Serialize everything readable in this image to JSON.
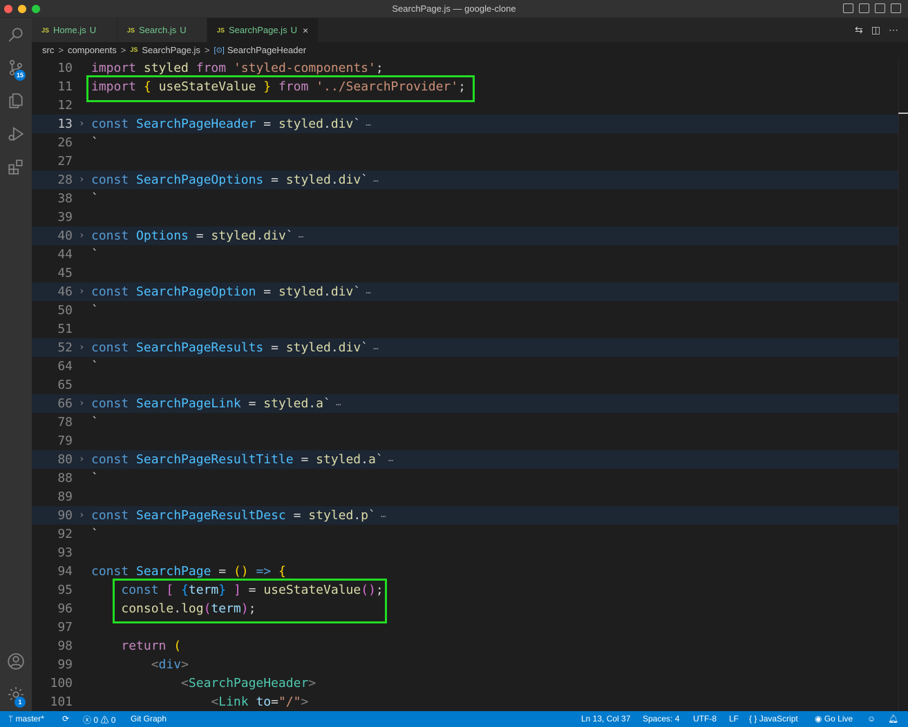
{
  "window": {
    "title": "SearchPage.js — google-clone"
  },
  "activity_bar": {
    "items": [
      {
        "name": "search-icon"
      },
      {
        "name": "source-control-icon",
        "badge": "15"
      },
      {
        "name": "explorer-icon"
      },
      {
        "name": "run-debug-icon"
      },
      {
        "name": "extensions-icon"
      }
    ],
    "bottom": [
      {
        "name": "account-icon"
      },
      {
        "name": "gear-icon",
        "badge": "1"
      }
    ]
  },
  "tabs": [
    {
      "icon": "JS",
      "label": "Home.js",
      "status": "U",
      "active": false
    },
    {
      "icon": "JS",
      "label": "Search.js",
      "status": "U",
      "active": false
    },
    {
      "icon": "JS",
      "label": "SearchPage.js",
      "status": "U",
      "active": true,
      "close": "×"
    }
  ],
  "breadcrumb": {
    "parts": [
      "src",
      "components",
      "SearchPage.js",
      "SearchPageHeader"
    ],
    "js_icon": "JS",
    "sep": ">"
  },
  "editor": {
    "line_numbers": [
      "10",
      "11",
      "12",
      "13",
      "26",
      "27",
      "28",
      "38",
      "39",
      "40",
      "44",
      "45",
      "46",
      "50",
      "51",
      "52",
      "64",
      "65",
      "66",
      "78",
      "79",
      "80",
      "88",
      "89",
      "90",
      "92",
      "93",
      "94",
      "95",
      "96",
      "97",
      "98",
      "99",
      "100",
      "101"
    ],
    "fold_ellipsis": "⋯",
    "lines": [
      "import styled from 'styled-components';",
      "import { useStateValue } from '../SearchProvider';",
      "",
      "const SearchPageHeader = styled.div`",
      "`",
      "",
      "const SearchPageOptions = styled.div`",
      "`",
      "",
      "const Options = styled.div`",
      "`",
      "",
      "const SearchPageOption = styled.div`",
      "`",
      "",
      "const SearchPageResults = styled.div`",
      "`",
      "",
      "const SearchPageLink = styled.a`",
      "`",
      "",
      "const SearchPageResultTitle = styled.a`",
      "`",
      "",
      "const SearchPageResultDesc = styled.p`",
      "`",
      "",
      "const SearchPage = () => {",
      "    const [ {term} ] = useStateValue();",
      "    console.log(term);",
      "",
      "    return (",
      "        <div>",
      "            <SearchPageHeader>",
      "                <Link to=\"/\">"
    ]
  },
  "statusbar": {
    "branch": "master*",
    "errors": "0",
    "warnings": "0",
    "git_graph": "Git Graph",
    "position": "Ln 13, Col 37",
    "spaces": "Spaces: 4",
    "encoding": "UTF-8",
    "eol": "LF",
    "language": "JavaScript",
    "language_icon": "{ }",
    "go_live": "Go Live"
  },
  "colors": {
    "highlight_box": "#22dd22",
    "status_bar": "#007acc",
    "activity_badge": "#0078d4"
  }
}
